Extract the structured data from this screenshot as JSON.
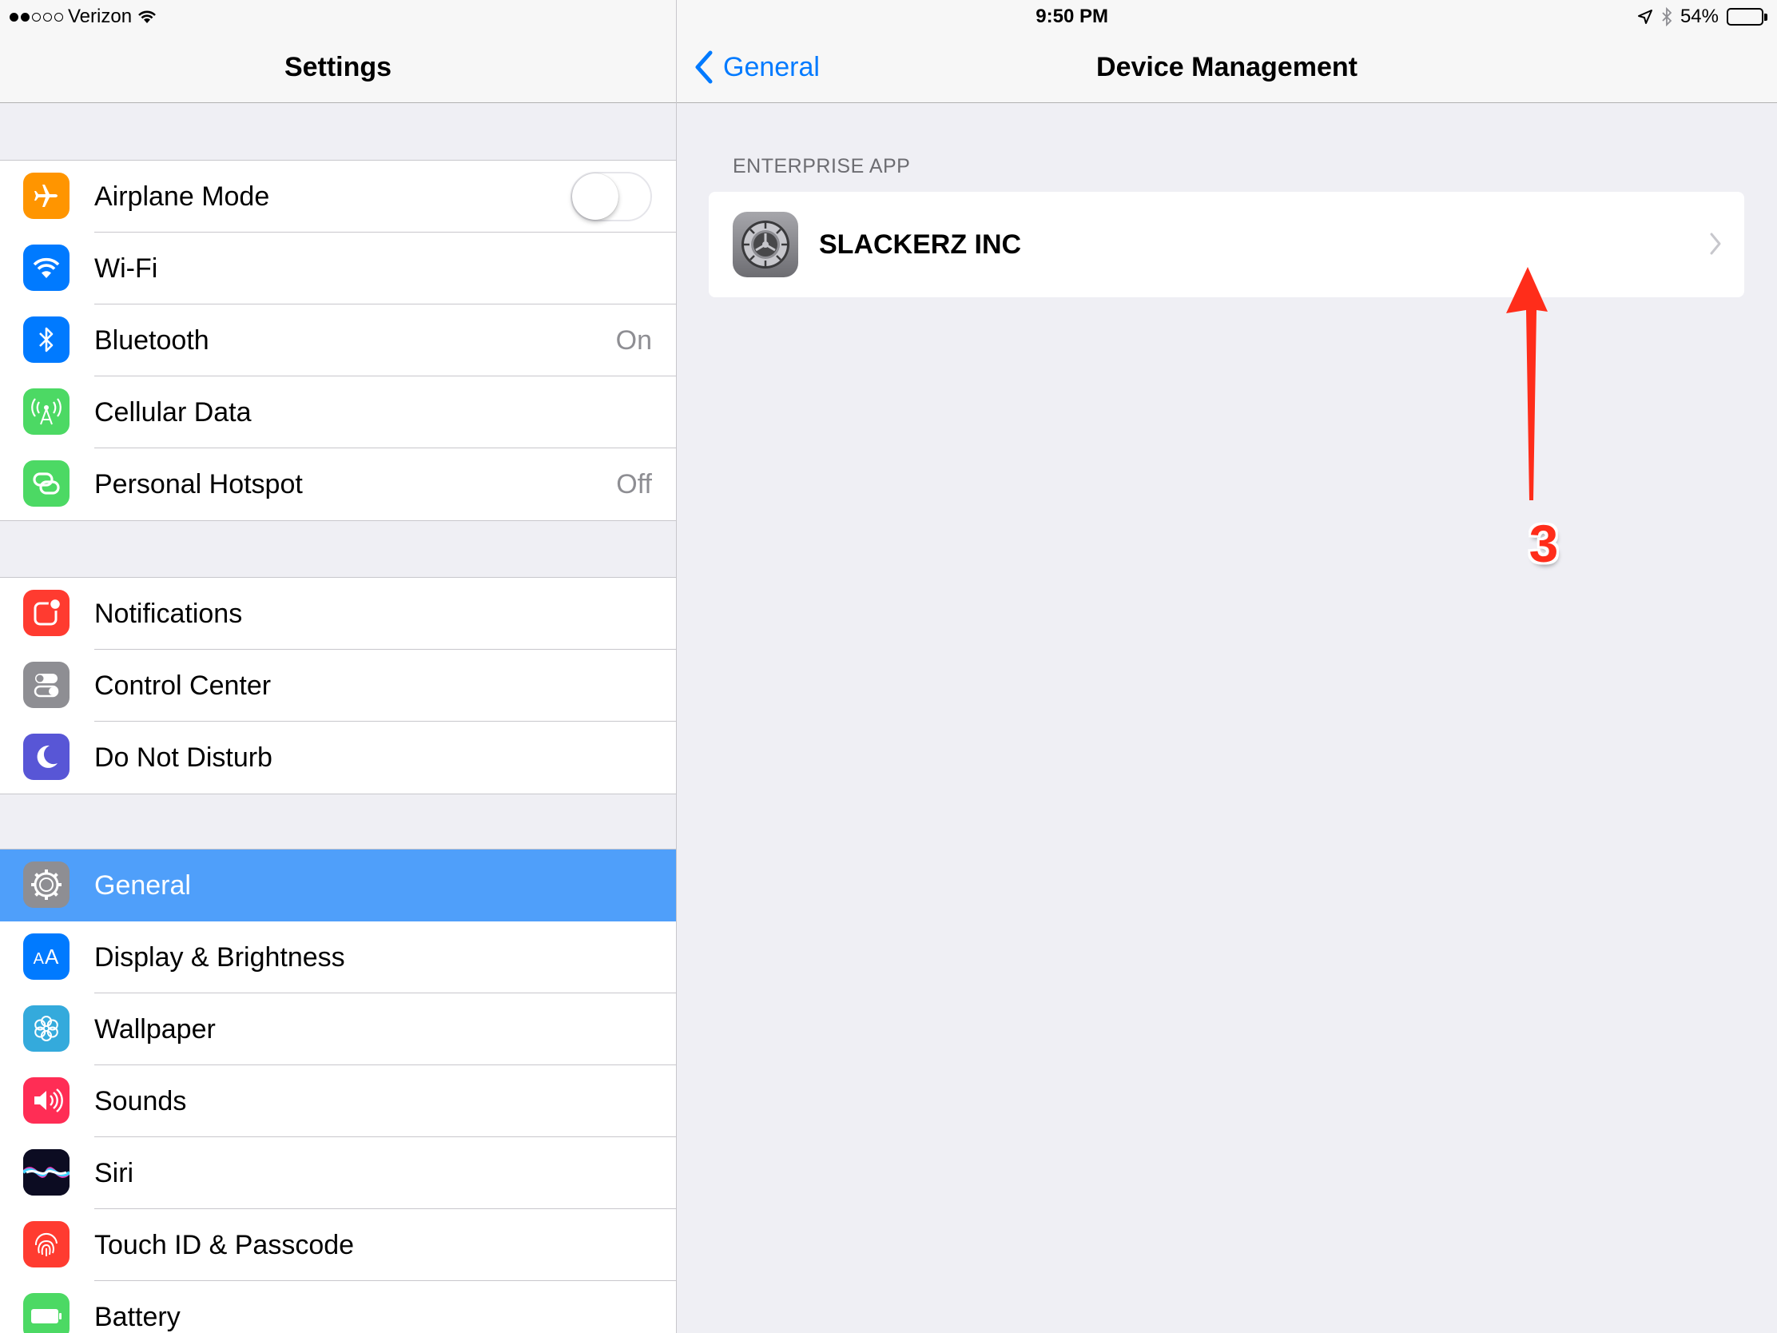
{
  "status_bar": {
    "carrier": "Verizon",
    "time": "9:50 PM",
    "battery": "54%",
    "battery_level": 0.54,
    "signal_bars_filled": 2,
    "signal_bars_total": 5
  },
  "master": {
    "title": "Settings",
    "groups": [
      {
        "items": [
          {
            "label": "Airplane Mode",
            "icon": "airplane-icon",
            "color": "#ff9500",
            "toggle": false
          },
          {
            "label": "Wi-Fi",
            "icon": "wifi-icon",
            "color": "#007aff"
          },
          {
            "label": "Bluetooth",
            "icon": "bluetooth-icon",
            "color": "#007aff",
            "value": "On"
          },
          {
            "label": "Cellular Data",
            "icon": "cellular-icon",
            "color": "#4cd964"
          },
          {
            "label": "Personal Hotspot",
            "icon": "hotspot-icon",
            "color": "#4cd964",
            "value": "Off"
          }
        ]
      },
      {
        "items": [
          {
            "label": "Notifications",
            "icon": "notifications-icon",
            "color": "#ff3b30"
          },
          {
            "label": "Control Center",
            "icon": "control-center-icon",
            "color": "#8e8e93"
          },
          {
            "label": "Do Not Disturb",
            "icon": "moon-icon",
            "color": "#5856d6"
          }
        ]
      },
      {
        "items": [
          {
            "label": "General",
            "icon": "gear-icon",
            "color": "#8e8e93",
            "selected": true
          },
          {
            "label": "Display & Brightness",
            "icon": "display-icon",
            "color": "#007aff"
          },
          {
            "label": "Wallpaper",
            "icon": "wallpaper-icon",
            "color": "#34aadc"
          },
          {
            "label": "Sounds",
            "icon": "sounds-icon",
            "color": "#ff2d55"
          },
          {
            "label": "Siri",
            "icon": "siri-icon",
            "color": "#1c1c3a"
          },
          {
            "label": "Touch ID & Passcode",
            "icon": "fingerprint-icon",
            "color": "#ff3b30"
          },
          {
            "label": "Battery",
            "icon": "battery-icon",
            "color": "#4cd964"
          }
        ]
      }
    ]
  },
  "detail": {
    "back_label": "General",
    "title": "Device Management",
    "section_header": "ENTERPRISE APP",
    "profile_name": "SLACKERZ INC",
    "annotation_step": "3",
    "accent_color": "#007aff",
    "annotation_color": "#ff2d1a"
  }
}
